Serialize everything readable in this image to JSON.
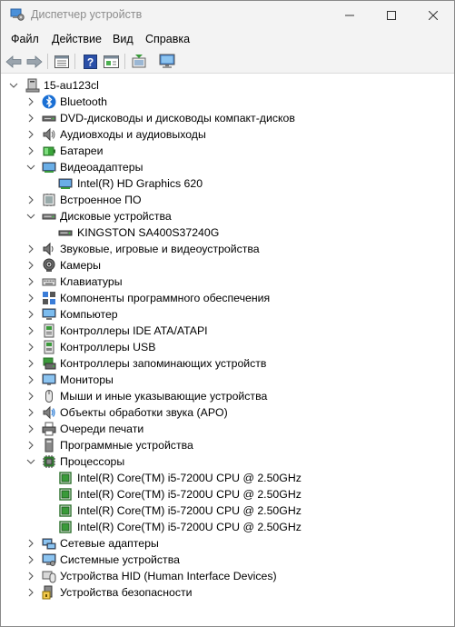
{
  "window": {
    "title": "Диспетчер устройств"
  },
  "menu": [
    "Файл",
    "Действие",
    "Вид",
    "Справка"
  ],
  "toolbar": {
    "buttons": [
      {
        "name": "back-button",
        "icon": "arrow-left-icon"
      },
      {
        "name": "forward-button",
        "icon": "arrow-right-icon"
      },
      {
        "name": "properties-view-button",
        "icon": "properties-list-icon"
      },
      {
        "name": "help-button",
        "icon": "help-icon"
      },
      {
        "name": "view-panel-button",
        "icon": "panel-icon"
      },
      {
        "name": "update-driver-button",
        "icon": "update-driver-icon"
      },
      {
        "name": "scan-hardware-button",
        "icon": "monitor-scan-icon"
      }
    ]
  },
  "tree": {
    "root": "15-au123cl",
    "categories": [
      {
        "label": "Bluetooth",
        "icon": "bluetooth-icon",
        "expanded": false
      },
      {
        "label": "DVD-дисководы и дисководы компакт-дисков",
        "icon": "dvd-drive-icon",
        "expanded": false
      },
      {
        "label": "Аудиовходы и аудиовыходы",
        "icon": "speaker-icon",
        "expanded": false
      },
      {
        "label": "Батареи",
        "icon": "battery-icon",
        "expanded": false
      },
      {
        "label": "Видеоадаптеры",
        "icon": "display-adapter-icon",
        "expanded": true,
        "children": [
          "Intel(R) HD Graphics 620"
        ]
      },
      {
        "label": "Встроенное ПО",
        "icon": "firmware-icon",
        "expanded": false
      },
      {
        "label": "Дисковые устройства",
        "icon": "disk-drive-icon",
        "expanded": true,
        "children": [
          "KINGSTON SA400S37240G"
        ]
      },
      {
        "label": "Звуковые, игровые и видеоустройства",
        "icon": "sound-device-icon",
        "expanded": false
      },
      {
        "label": "Камеры",
        "icon": "camera-icon",
        "expanded": false
      },
      {
        "label": "Клавиатуры",
        "icon": "keyboard-icon",
        "expanded": false
      },
      {
        "label": "Компоненты программного обеспечения",
        "icon": "software-component-icon",
        "expanded": false
      },
      {
        "label": "Компьютер",
        "icon": "computer-icon",
        "expanded": false
      },
      {
        "label": "Контроллеры IDE ATA/ATAPI",
        "icon": "ide-controller-icon",
        "expanded": false
      },
      {
        "label": "Контроллеры USB",
        "icon": "usb-controller-icon",
        "expanded": false
      },
      {
        "label": "Контроллеры запоминающих устройств",
        "icon": "storage-controller-icon",
        "expanded": false
      },
      {
        "label": "Мониторы",
        "icon": "monitor-icon",
        "expanded": false
      },
      {
        "label": "Мыши и иные указывающие устройства",
        "icon": "mouse-icon",
        "expanded": false
      },
      {
        "label": "Объекты обработки звука (APO)",
        "icon": "audio-processing-icon",
        "expanded": false
      },
      {
        "label": "Очереди печати",
        "icon": "printer-icon",
        "expanded": false
      },
      {
        "label": "Программные устройства",
        "icon": "software-device-icon",
        "expanded": false
      },
      {
        "label": "Процессоры",
        "icon": "processor-icon",
        "expanded": true,
        "children": [
          "Intel(R) Core(TM) i5-7200U CPU @ 2.50GHz",
          "Intel(R) Core(TM) i5-7200U CPU @ 2.50GHz",
          "Intel(R) Core(TM) i5-7200U CPU @ 2.50GHz",
          "Intel(R) Core(TM) i5-7200U CPU @ 2.50GHz"
        ]
      },
      {
        "label": "Сетевые адаптеры",
        "icon": "network-adapter-icon",
        "expanded": false
      },
      {
        "label": "Системные устройства",
        "icon": "system-device-icon",
        "expanded": false
      },
      {
        "label": "Устройства HID (Human Interface Devices)",
        "icon": "hid-device-icon",
        "expanded": false
      },
      {
        "label": "Устройства безопасности",
        "icon": "security-device-icon",
        "expanded": false
      }
    ]
  }
}
